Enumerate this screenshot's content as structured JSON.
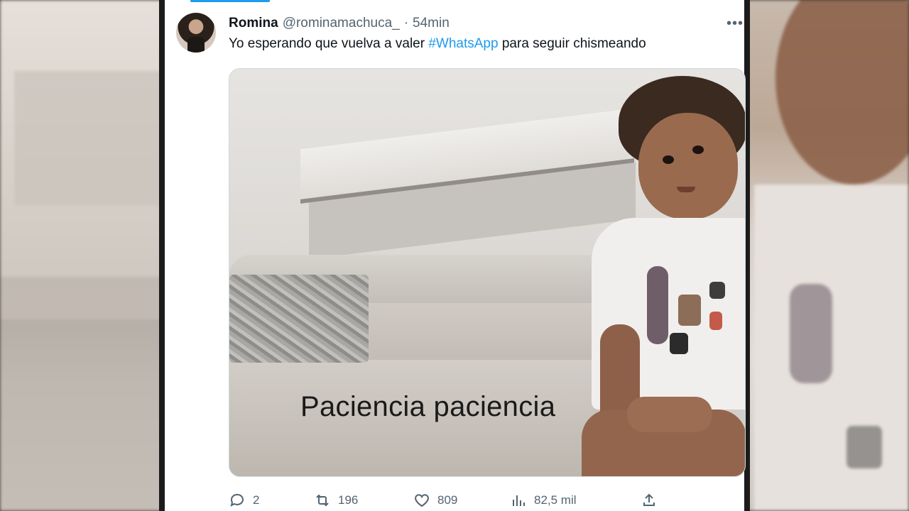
{
  "tweet": {
    "display_name": "Romina",
    "handle": "@rominamachuca_",
    "separator": "·",
    "time": "54min",
    "more_icon": "more-options-icon",
    "text_before": "Yo esperando que vuelva a valer ",
    "hashtag": "#WhatsApp",
    "text_after": " para seguir chismeando",
    "media_caption": "Paciencia paciencia",
    "accent_color": "#1d9bf0"
  },
  "actions": {
    "reply_count": "2",
    "retweet_count": "196",
    "like_count": "809",
    "views_count": "82,5 mil"
  }
}
